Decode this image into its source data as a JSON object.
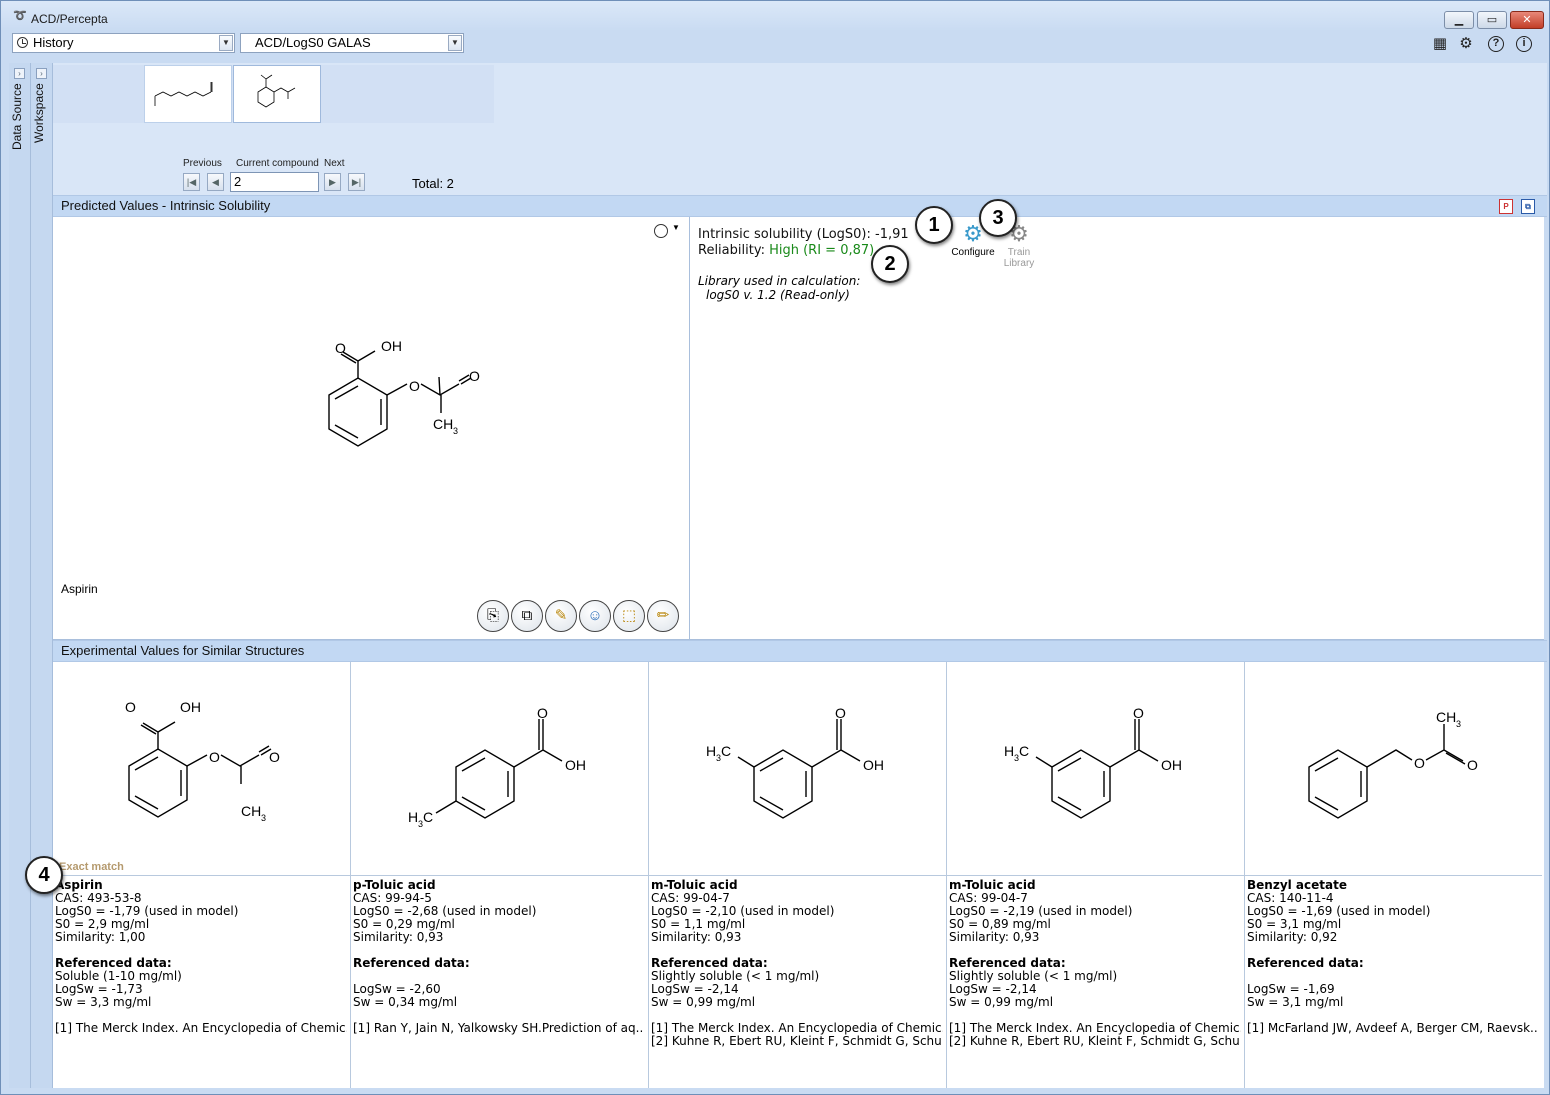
{
  "window": {
    "title": "ACD/Percepta",
    "min": "▁",
    "max": "▭",
    "close": "✕"
  },
  "toolbar": {
    "history_label": "History",
    "module_label": "ACD/LogS0 GALAS",
    "icons": [
      "calculator-icon",
      "gear-icon",
      "help-icon",
      "info-icon"
    ]
  },
  "sidebar": {
    "data_source": "Data Source",
    "workspace": "Workspace"
  },
  "navigator": {
    "previous_label": "Previous",
    "current_label": "Current compound",
    "next_label": "Next",
    "current_value": "2",
    "total": "Total: 2"
  },
  "predicted": {
    "header": "Predicted Values - Intrinsic Solubility",
    "line1": "Intrinsic solubility (LogS0): -1,91",
    "reliability_label": "Reliability: ",
    "reliability_value": "High (RI = 0,87)",
    "library_line1": "Library used in calculation:",
    "library_line2": "logS0 v. 1.2 (Read-only)",
    "configure": "Configure",
    "train_line1": "Train",
    "train_line2": "Library",
    "compound_name": "Aspirin"
  },
  "callouts": {
    "c1": "1",
    "c2": "2",
    "c3": "3",
    "c4": "4"
  },
  "experimental": {
    "header": "Experimental Values for Similar Structures",
    "exact_match": "Exact match",
    "cards": [
      {
        "name": "Aspirin",
        "cas": "CAS: 493-53-8",
        "logs0": "LogS0 = -1,79 (used in model)",
        "s0": "S0 = 2,9 mg/ml",
        "similarity": "Similarity:  1,00",
        "ref_title": "Referenced data:",
        "ref1": "Soluble (1-10 mg/ml)",
        "ref2": "LogSw = -1,73",
        "ref3": "Sw = 3,3 mg/ml",
        "cite1": "[1] The Merck Index. An Encyclopedia of Chemic..",
        "cite2": ""
      },
      {
        "name": "p-Toluic acid",
        "cas": "CAS: 99-94-5",
        "logs0": "LogS0 = -2,68 (used in model)",
        "s0": "S0 = 0,29 mg/ml",
        "similarity": "Similarity:  0,93",
        "ref_title": "Referenced data:",
        "ref1": "",
        "ref2": "LogSw = -2,60",
        "ref3": "Sw = 0,34 mg/ml",
        "cite1": "[1] Ran Y, Jain N, Yalkowsky SH.Prediction of aq..",
        "cite2": ""
      },
      {
        "name": "m-Toluic acid",
        "cas": "CAS: 99-04-7",
        "logs0": "LogS0 = -2,10 (used in model)",
        "s0": "S0 = 1,1 mg/ml",
        "similarity": "Similarity:  0,93",
        "ref_title": "Referenced data:",
        "ref1": "Slightly soluble (< 1 mg/ml)",
        "ref2": "LogSw = -2,14",
        "ref3": "Sw = 0,99 mg/ml",
        "cite1": "[1] The Merck Index. An Encyclopedia of Chemic..",
        "cite2": "[2] Kuhne R, Ebert RU, Kleint F, Schmidt G, Schu.."
      },
      {
        "name": "m-Toluic acid",
        "cas": "CAS: 99-04-7",
        "logs0": "LogS0 = -2,19 (used in model)",
        "s0": "S0 = 0,89 mg/ml",
        "similarity": "Similarity:  0,93",
        "ref_title": "Referenced data:",
        "ref1": "Slightly soluble (< 1 mg/ml)",
        "ref2": "LogSw = -2,14",
        "ref3": "Sw = 0,99 mg/ml",
        "cite1": "[1] The Merck Index. An Encyclopedia of Chemic..",
        "cite2": "[2] Kuhne R, Ebert RU, Kleint F, Schmidt G, Schu.."
      },
      {
        "name": "Benzyl acetate",
        "cas": "CAS: 140-11-4",
        "logs0": "LogS0 = -1,69 (used in model)",
        "s0": "S0 = 3,1 mg/ml",
        "similarity": "Similarity:  0,92",
        "ref_title": "Referenced data:",
        "ref1": "",
        "ref2": "LogSw = -1,69",
        "ref3": "Sw = 3,1 mg/ml",
        "cite1": "[1] McFarland JW, Avdeef A, Berger CM, Raevsk..",
        "cite2": ""
      }
    ]
  },
  "structure_labels": {
    "oh": "OH",
    "o": "O",
    "ch3": "CH",
    "sub3": "3",
    "h3c": "H",
    "c": "C"
  },
  "colors": {
    "success": "#1a8a1a",
    "exact_match": "#b59a6e",
    "header_bg": "#c2d8f3"
  }
}
